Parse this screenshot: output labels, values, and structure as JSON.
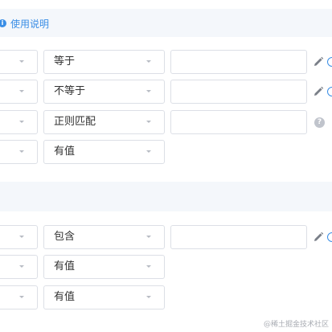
{
  "usage_link": {
    "label": "使用说明",
    "icon": "info-icon"
  },
  "group1": {
    "rows": [
      {
        "operator": "等于",
        "has_value_input": true,
        "icon": "pencil-icon"
      },
      {
        "operator": "不等于",
        "has_value_input": true,
        "icon": "pencil-icon"
      },
      {
        "operator": "正则匹配",
        "has_value_input": true,
        "icon": "help-icon",
        "help_symbol": "?"
      },
      {
        "operator": "有值",
        "has_value_input": false
      }
    ]
  },
  "group2": {
    "rows": [
      {
        "operator": "包含",
        "has_value_input": true,
        "icon": "pencil-icon"
      },
      {
        "operator": "有值",
        "has_value_input": false
      },
      {
        "operator": "有值",
        "has_value_input": false
      }
    ]
  },
  "watermark": "@稀土掘金技术社区",
  "colors": {
    "accent": "#3a8ee6",
    "border": "#dcdfe6",
    "header_bg": "#f4f7fb",
    "icon_gray": "#7a7f88"
  }
}
